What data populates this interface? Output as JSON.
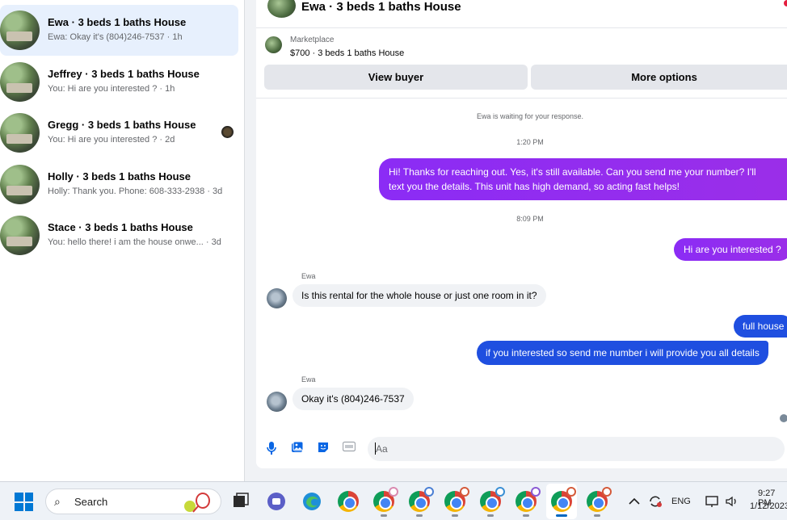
{
  "conversations": [
    {
      "name": "Ewa · 3 beds 1 baths House",
      "snippet": "Ewa: Okay it's (804)246-7537 · 1h",
      "active": true
    },
    {
      "name": "Jeffrey · 3 beds 1 baths House",
      "snippet": "You: Hi are you interested ? · 1h"
    },
    {
      "name": "Gregg · 3 beds 1 baths House",
      "snippet": "You: Hi are you interested ? · 2d"
    },
    {
      "name": "Holly · 3 beds 1 baths House",
      "snippet": "Holly: Thank you. Phone: 608-333-2938 · 3d"
    },
    {
      "name": "Stace · 3 beds 1 baths House",
      "snippet": "You: hello there! i am the house onwe...  · 3d"
    }
  ],
  "chat": {
    "title": "Ewa · 3 beds 1 baths House",
    "marketplace_label": "Marketplace",
    "listing": "$700 · 3 beds 1 baths House",
    "view_buyer": "View buyer",
    "more_options": "More options",
    "waiting": "Ewa is waiting for your response.",
    "time1": "1:20 PM",
    "msg1_line1": "Hi! Thanks for reaching out. Yes, it's still available. Can you send me your number? I'll",
    "msg1_line2": "text you the details. This unit has high demand, so acting fast helps!",
    "time2": "8:09 PM",
    "msg2": "Hi are you interested ?",
    "sender1": "Ewa",
    "msg3": "Is this rental for the whole house or just one room in it?",
    "msg4": "full house",
    "msg5": "if you interested so send me number i will provide you all details",
    "sender2": "Ewa",
    "msg6": "Okay it's (804)246-7537",
    "composer_placeholder": "Aa"
  },
  "taskbar": {
    "search_label": "Search",
    "language": "ENG",
    "time": "9:27 PM",
    "date": "1/12/2023"
  },
  "colors": {
    "outgoing_purple": "#8b2cf5",
    "outgoing_blue": "#1f4fe0",
    "accent": "#0a66e4",
    "active_conversation": "#e7f0fd"
  }
}
